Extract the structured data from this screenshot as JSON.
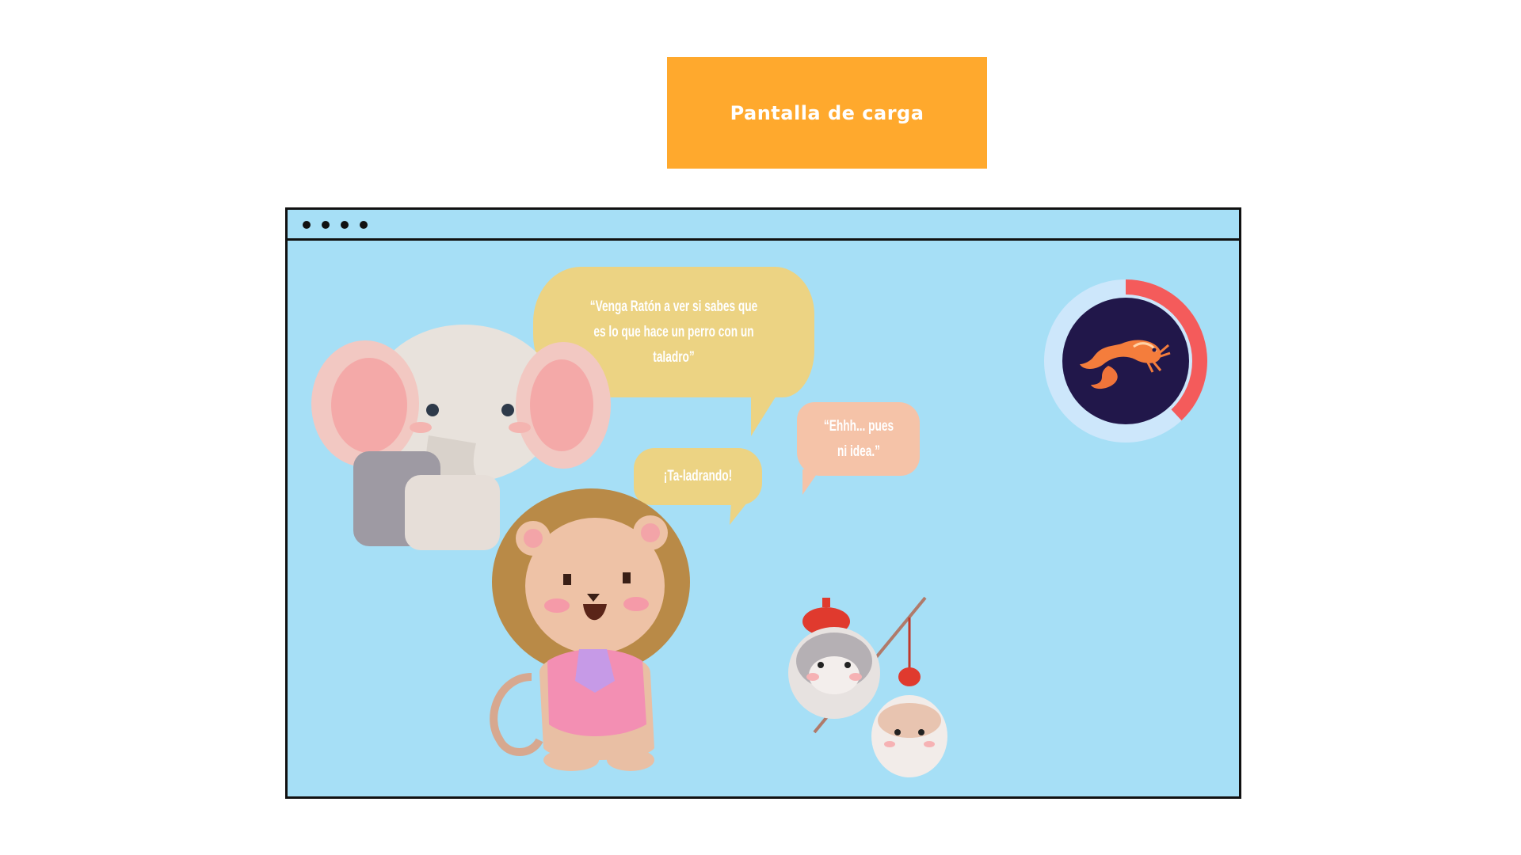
{
  "header": {
    "title": "Pantalla de carga"
  },
  "speech": {
    "elephant": "“Venga Ratón a ver si sabes que es lo que hace un perro con un taladro”",
    "lion": "¡Ta-ladrando!",
    "hamster": "“Ehhh... pues ni idea.”"
  },
  "loader": {
    "progress": 0.38,
    "icon": "shrimp-icon"
  },
  "colors": {
    "banner": "#ffa92d",
    "screen_bg": "#a6dff6",
    "bubble_yellow": "#ecd383",
    "bubble_peach": "#f5c3a8",
    "loader_track": "#cde7fb",
    "loader_fill": "#f45b5b",
    "loader_center": "#21174a"
  }
}
